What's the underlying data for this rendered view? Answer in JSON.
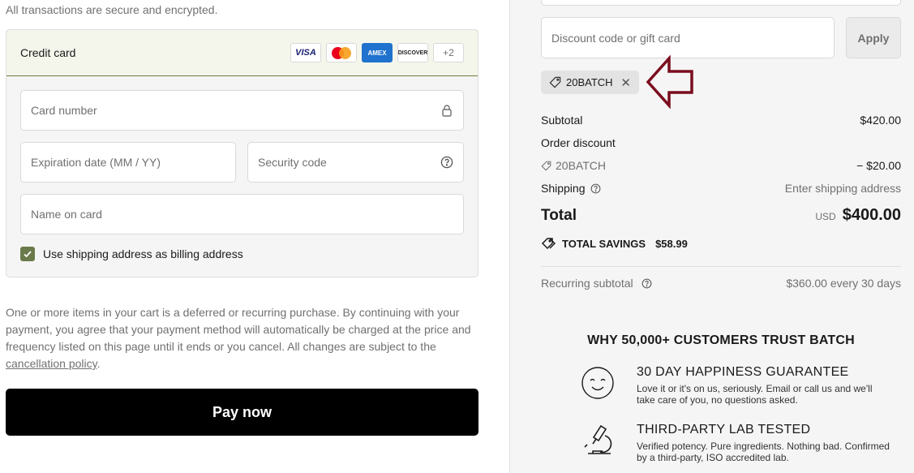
{
  "payment": {
    "secure_note": "All transactions are secure and encrypted.",
    "method_title": "Credit card",
    "card_brands": [
      "VISA",
      "MC",
      "AMEX",
      "DISCOVER"
    ],
    "more_cards": "+2",
    "card_number_placeholder": "Card number",
    "expiration_placeholder": "Expiration date (MM / YY)",
    "security_code_placeholder": "Security code",
    "name_placeholder": "Name on card",
    "billing_checkbox_label": "Use shipping address as billing address",
    "billing_checked": true,
    "recurring_note": "One or more items in your cart is a deferred or recurring purchase. By continuing with your payment, you agree that your payment method will automatically be charged at the price and frequency listed on this page until it ends or you cancel. All changes are subject to the",
    "cancellation_link": "cancellation policy",
    "recurring_note_end": ".",
    "pay_button": "Pay now"
  },
  "summary": {
    "discount_placeholder": "Discount code or gift card",
    "apply_button": "Apply",
    "applied_code": "20BATCH",
    "subtotal_label": "Subtotal",
    "subtotal_value": "$420.00",
    "order_discount_label": "Order discount",
    "discount_code": "20BATCH",
    "discount_value": "− $20.00",
    "shipping_label": "Shipping",
    "shipping_value": "Enter shipping address",
    "total_label": "Total",
    "total_currency": "USD",
    "total_value": "$400.00",
    "savings_label": "TOTAL SAVINGS",
    "savings_value": "$58.99",
    "recurring_label": "Recurring subtotal",
    "recurring_value": "$360.00 every 30 days"
  },
  "trust": {
    "title": "WHY 50,000+ CUSTOMERS TRUST BATCH",
    "items": [
      {
        "icon": "smiley-icon",
        "heading": "30 DAY HAPPINESS GUARANTEE",
        "text": "Love it or it's on us, seriously. Email or call us and we'll take care of you, no questions asked."
      },
      {
        "icon": "microscope-icon",
        "heading": "THIRD-PARTY LAB TESTED",
        "text": "Verified potency. Pure ingredients. Nothing bad. Confirmed by a third-party, ISO accredited lab."
      }
    ]
  },
  "colors": {
    "accent": "#6b7a4a",
    "arrow": "#7a0d1e",
    "pay_button": "#000000"
  }
}
